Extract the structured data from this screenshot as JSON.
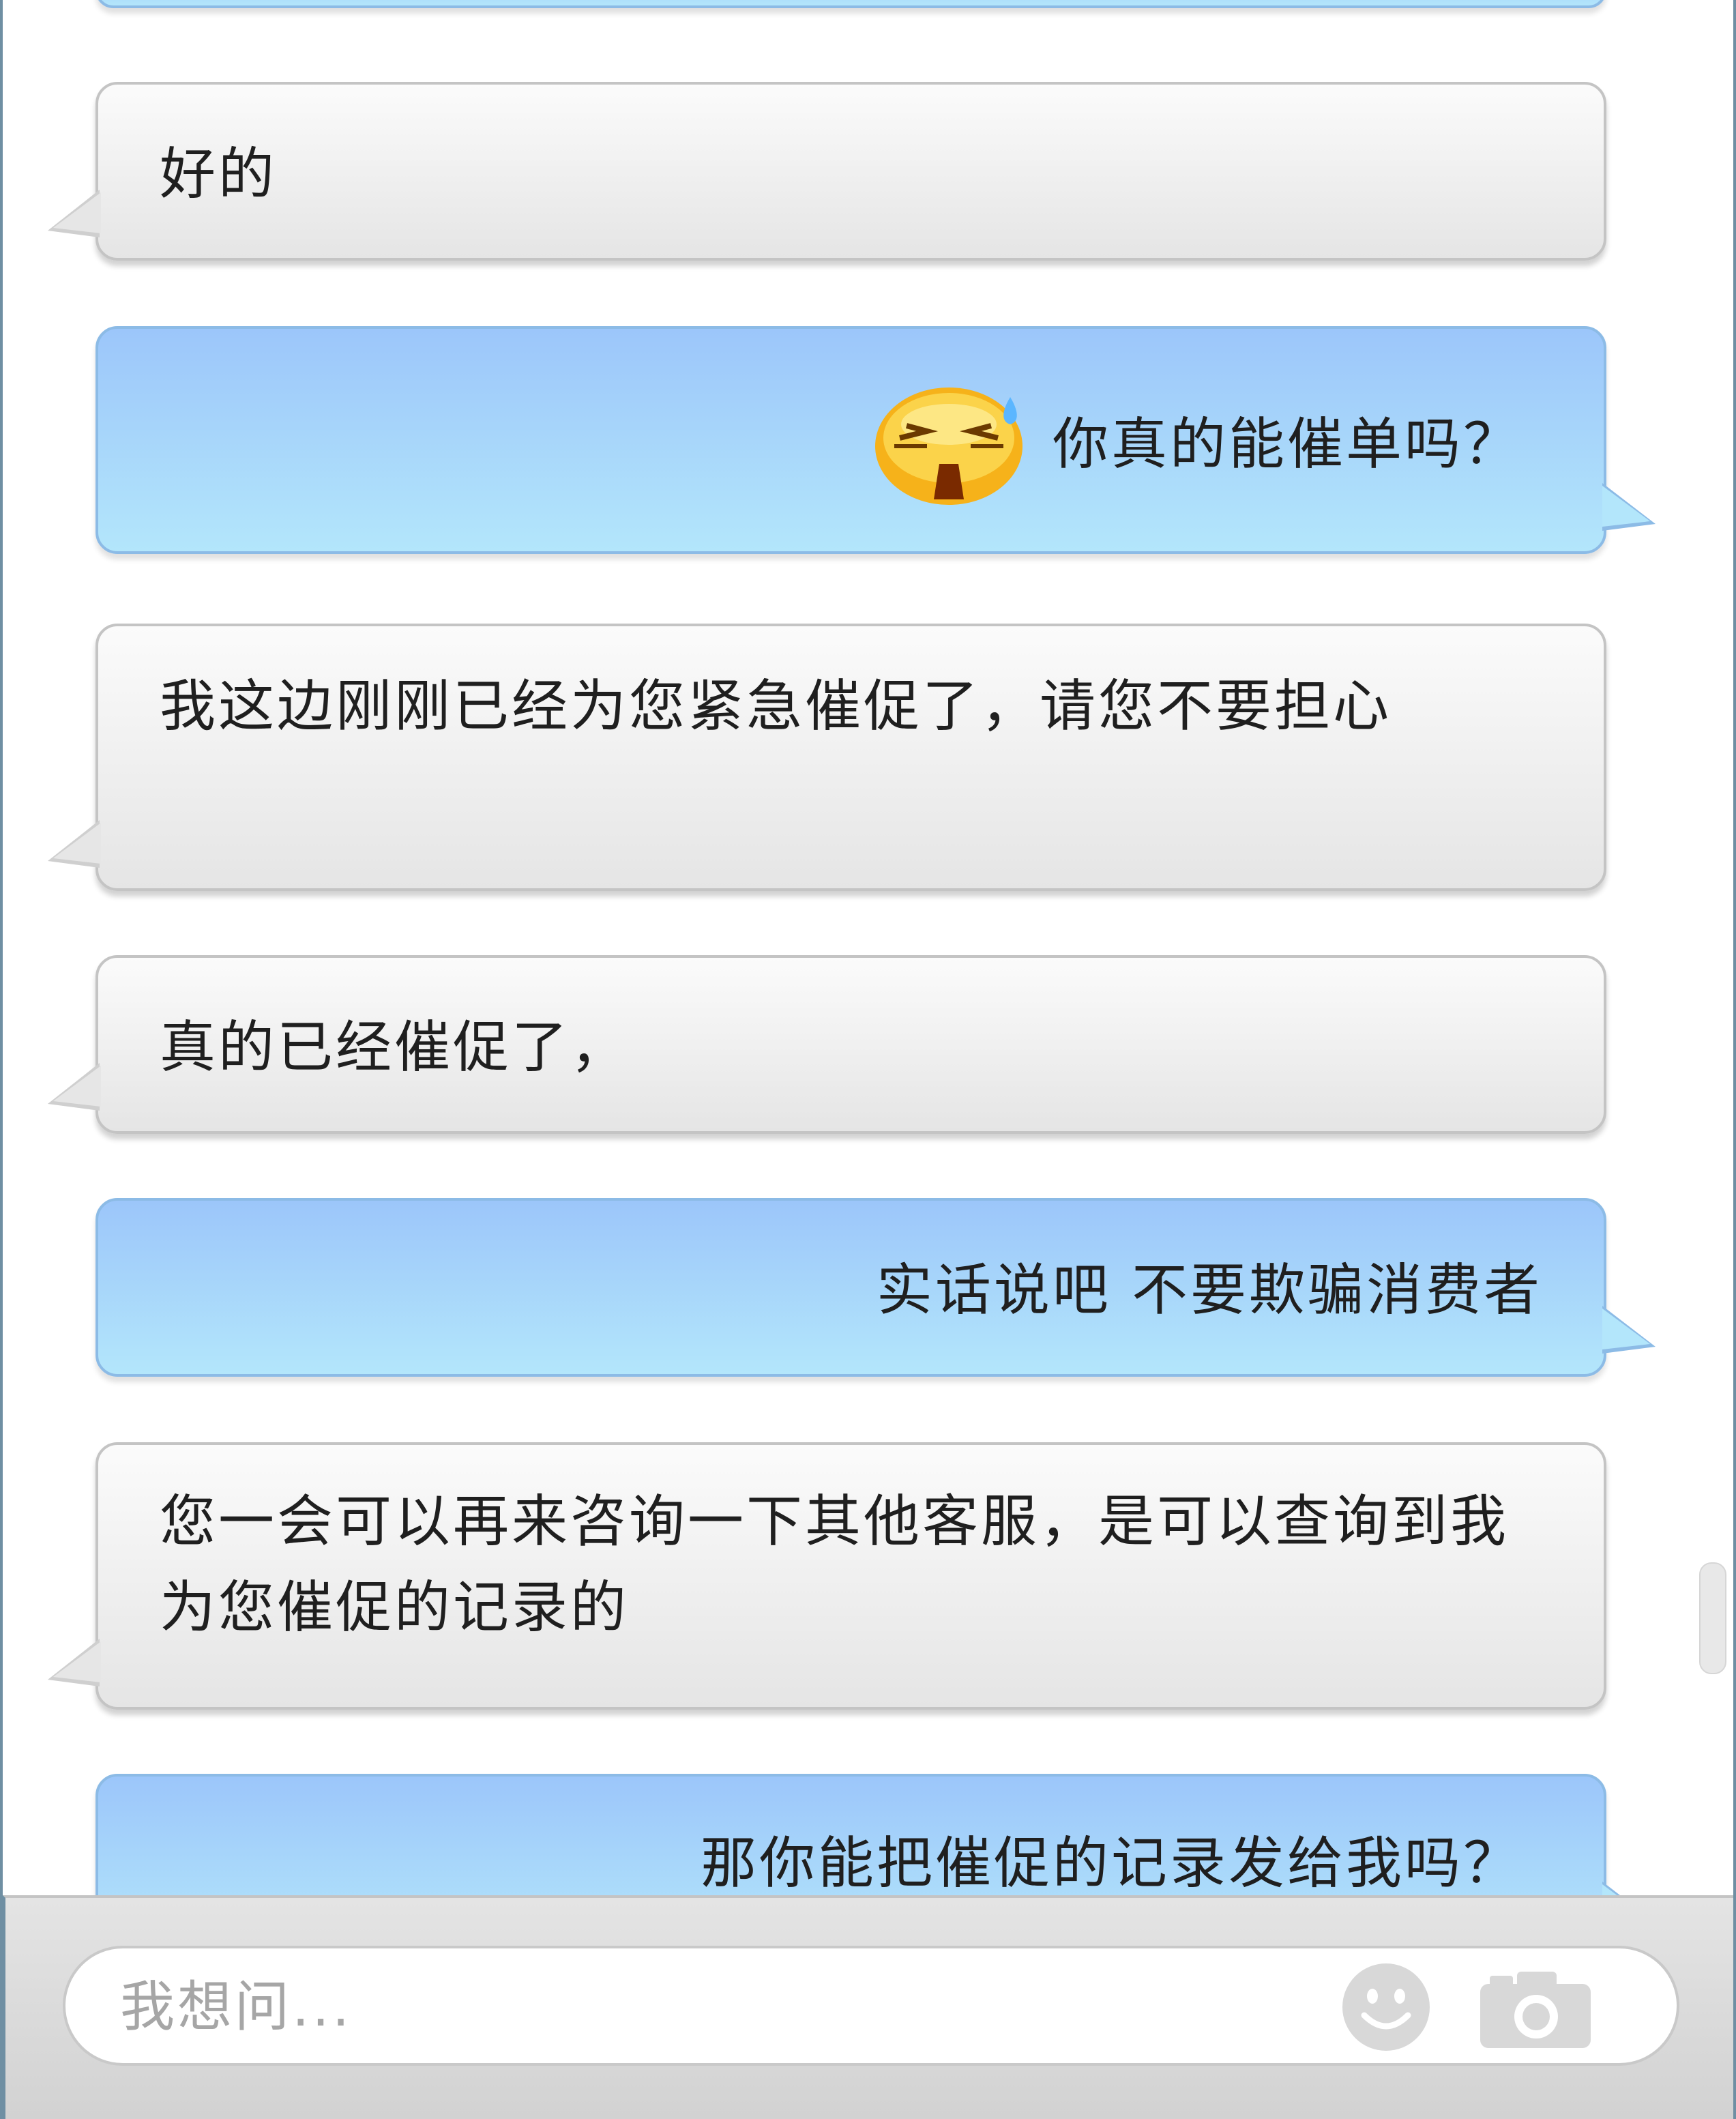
{
  "messages": [
    {
      "sender": "agent",
      "text": "好的"
    },
    {
      "sender": "user",
      "text": "你真的能催单吗？",
      "emoji": "sweating-upset-emoji"
    },
    {
      "sender": "agent",
      "text": "我这边刚刚已经为您紧急催促了，请您不要担心"
    },
    {
      "sender": "agent",
      "text": "真的已经催促了，"
    },
    {
      "sender": "user",
      "text": "实话说吧 不要欺骗消费者"
    },
    {
      "sender": "agent",
      "text": "您一会可以再来咨询一下其他客服，是可以查询到我为您催促的记录的"
    },
    {
      "sender": "user",
      "text": "那你能把催促的记录发给我吗？"
    }
  ],
  "input": {
    "placeholder": "我想问...",
    "value": ""
  },
  "icons": {
    "emoji_button": "smiley-icon",
    "camera_button": "camera-icon"
  },
  "colors": {
    "user_bubble_top": "#9cc6fa",
    "user_bubble_bottom": "#b3e6fb",
    "agent_bubble_top": "#fbfbfb",
    "agent_bubble_bottom": "#e5e5e5",
    "input_bar": "#d9d9d9"
  }
}
